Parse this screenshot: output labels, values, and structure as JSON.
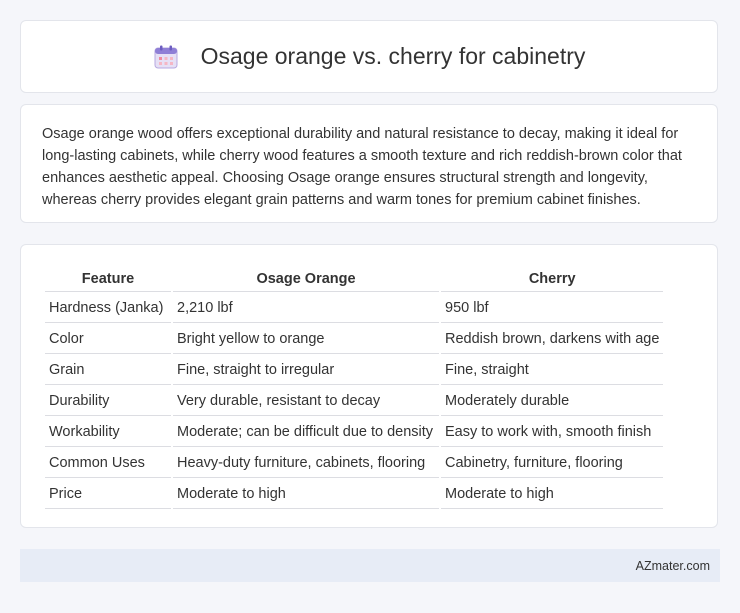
{
  "header": {
    "icon": "calendar-icon",
    "title": "Osage orange vs. cherry for cabinetry"
  },
  "intro": {
    "text": "Osage orange wood offers exceptional durability and natural resistance to decay, making it ideal for long-lasting cabinets, while cherry wood features a smooth texture and rich reddish-brown color that enhances aesthetic appeal. Choosing Osage orange ensures structural strength and longevity, whereas cherry provides elegant grain patterns and warm tones for premium cabinet finishes."
  },
  "table": {
    "headers": [
      "Feature",
      "Osage Orange",
      "Cherry"
    ],
    "rows": [
      [
        "Hardness (Janka)",
        "2,210 lbf",
        "950 lbf"
      ],
      [
        "Color",
        "Bright yellow to orange",
        "Reddish brown, darkens with age"
      ],
      [
        "Grain",
        "Fine, straight to irregular",
        "Fine, straight"
      ],
      [
        "Durability",
        "Very durable, resistant to decay",
        "Moderately durable"
      ],
      [
        "Workability",
        "Moderate; can be difficult due to density",
        "Easy to work with, smooth finish"
      ],
      [
        "Common Uses",
        "Heavy-duty furniture, cabinets, flooring",
        "Cabinetry, furniture, flooring"
      ],
      [
        "Price",
        "Moderate to high",
        "Moderate to high"
      ]
    ]
  },
  "footer": {
    "source": "AZmater.com"
  }
}
